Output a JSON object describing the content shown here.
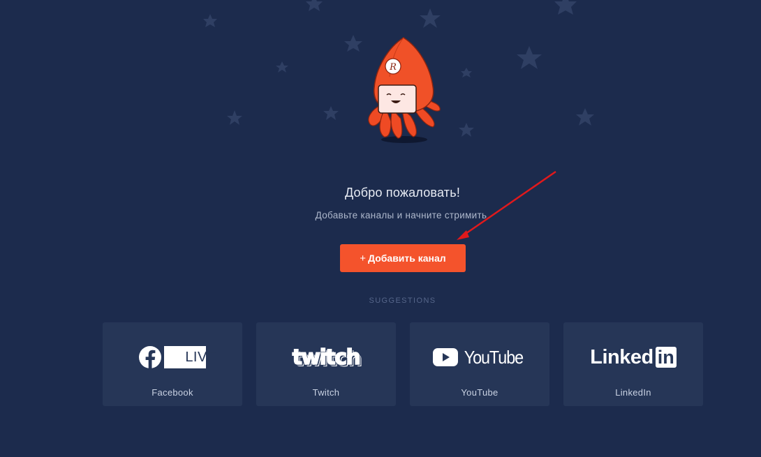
{
  "welcome": {
    "title": "Добро пожаловать!",
    "subtitle": "Добавьте каналы и начните стримить."
  },
  "add_button": {
    "plus": "+",
    "label": "Добавить канал"
  },
  "suggestions": {
    "heading": "SUGGESTIONS",
    "items": [
      {
        "label": "Facebook",
        "logo_text": "LIVE",
        "icon": "facebook-live-logo-icon"
      },
      {
        "label": "Twitch",
        "logo_text": "twitch",
        "icon": "twitch-logo-icon"
      },
      {
        "label": "YouTube",
        "logo_text": "YouTube",
        "icon": "youtube-logo-icon"
      },
      {
        "label": "LinkedIn",
        "logo_text": "Linked",
        "logo_badge": "in",
        "icon": "linkedin-logo-icon"
      }
    ]
  },
  "mascot": {
    "icon": "squid-mascot-icon",
    "badge_letter": "R"
  },
  "colors": {
    "background": "#1c2b4d",
    "card": "#263657",
    "accent": "#f4532c",
    "star": "#2f3f63",
    "annotation_arrow": "#e0191c"
  }
}
